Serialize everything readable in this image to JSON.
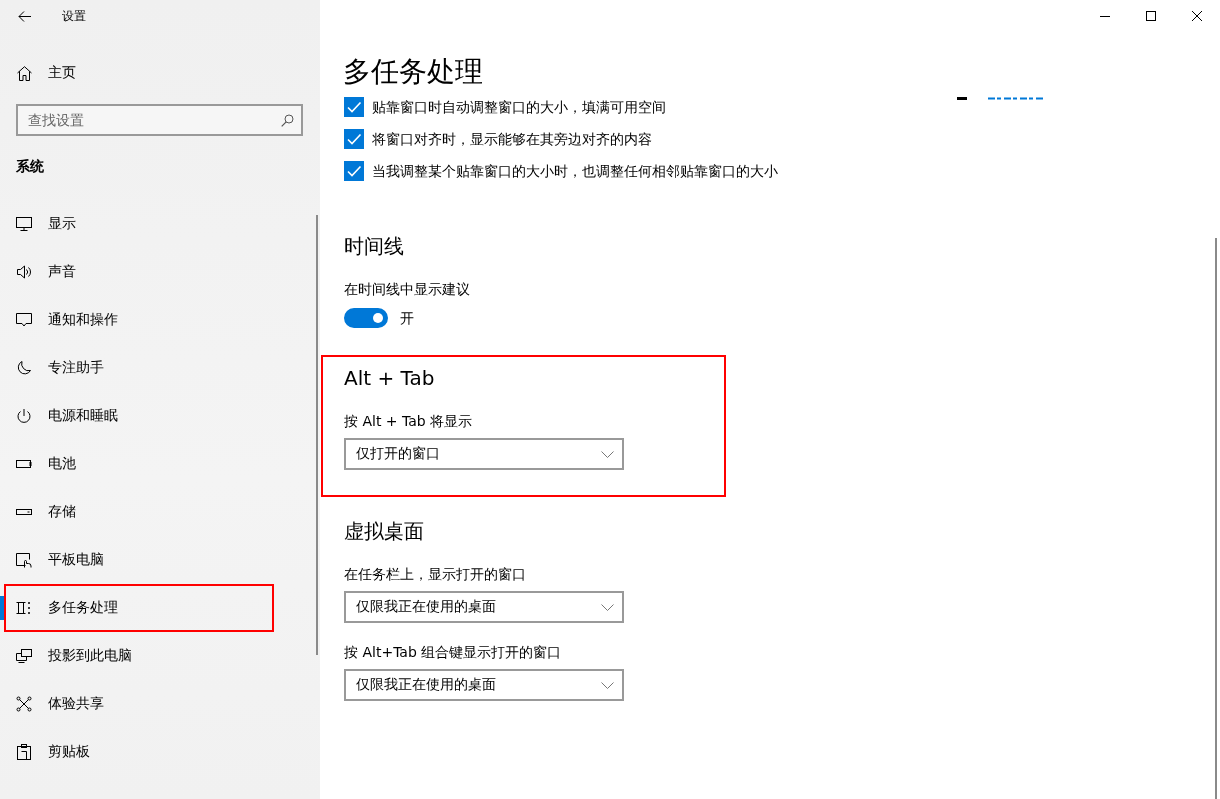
{
  "window": {
    "title": "设置"
  },
  "sidebar": {
    "home": "主页",
    "search": {
      "placeholder": "查找设置"
    },
    "group": "系统",
    "items": [
      {
        "label": "显示",
        "selected": false,
        "highlighted": false
      },
      {
        "label": "声音",
        "selected": false,
        "highlighted": false
      },
      {
        "label": "通知和操作",
        "selected": false,
        "highlighted": false
      },
      {
        "label": "专注助手",
        "selected": false,
        "highlighted": false
      },
      {
        "label": "电源和睡眠",
        "selected": false,
        "highlighted": false
      },
      {
        "label": "电池",
        "selected": false,
        "highlighted": false
      },
      {
        "label": "存储",
        "selected": false,
        "highlighted": false
      },
      {
        "label": "平板电脑",
        "selected": false,
        "highlighted": false
      },
      {
        "label": "多任务处理",
        "selected": true,
        "highlighted": true
      },
      {
        "label": "投影到此电脑",
        "selected": false,
        "highlighted": false
      },
      {
        "label": "体验共享",
        "selected": false,
        "highlighted": false
      },
      {
        "label": "剪贴板",
        "selected": false,
        "highlighted": false
      }
    ]
  },
  "page": {
    "title": "多任务处理",
    "snap_options": [
      {
        "label": "贴靠窗口时自动调整窗口的大小，填满可用空间",
        "checked": true
      },
      {
        "label": "将窗口对齐时，显示能够在其旁边对齐的内容",
        "checked": true
      },
      {
        "label": "当我调整某个贴靠窗口的大小时，也调整任何相邻贴靠窗口的大小",
        "checked": true
      }
    ],
    "sections": [
      {
        "heading": "时间线",
        "highlighted": false,
        "settings": [
          {
            "kind": "toggle",
            "label": "在时间线中显示建议",
            "on": true,
            "state_text": "开"
          }
        ]
      },
      {
        "heading": "Alt + Tab",
        "highlighted": true,
        "settings": [
          {
            "kind": "dropdown",
            "label": "按 Alt + Tab 将显示",
            "value": "仅打开的窗口"
          }
        ]
      },
      {
        "heading": "虚拟桌面",
        "highlighted": false,
        "settings": [
          {
            "kind": "dropdown",
            "label": "在任务栏上，显示打开的窗口",
            "value": "仅限我正在使用的桌面"
          },
          {
            "kind": "dropdown",
            "label": "按 Alt+Tab 组合键显示打开的窗口",
            "value": "仅限我正在使用的桌面"
          }
        ]
      }
    ]
  }
}
